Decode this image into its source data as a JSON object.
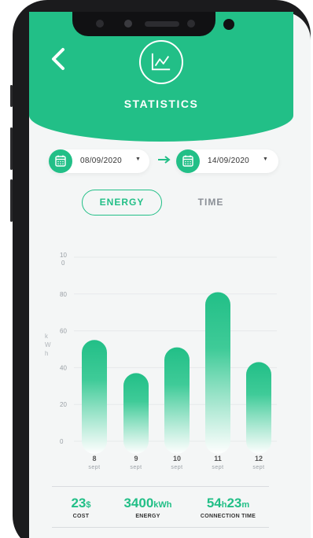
{
  "header": {
    "title": "STATISTICS"
  },
  "date_range": {
    "start": "08/09/2020",
    "end": "14/09/2020"
  },
  "tabs": [
    {
      "label": "ENERGY",
      "active": true
    },
    {
      "label": "TIME",
      "active": false
    }
  ],
  "chart_data": {
    "type": "bar",
    "ylabel": "kWh",
    "yticks": [
      "100",
      "80",
      "60",
      "40",
      "20",
      "0"
    ],
    "ylim": [
      0,
      100
    ],
    "categories": [
      "8",
      "9",
      "10",
      "11",
      "12"
    ],
    "category_sublabel": "sept",
    "values": [
      55,
      37,
      51,
      81,
      43
    ],
    "bar_color": "#22bf87",
    "grid": true
  },
  "summary": {
    "cost": {
      "value": "23",
      "unit": "$",
      "label": "COST"
    },
    "energy": {
      "value": "3400",
      "unit": "kWh",
      "label": "ENERGY"
    },
    "connection": {
      "hours": "54",
      "h_unit": "h",
      "minutes": "23",
      "m_unit": "m",
      "label": "CONNECTION TIME"
    }
  },
  "colors": {
    "accent": "#22bf87",
    "background": "#f4f6f6"
  }
}
